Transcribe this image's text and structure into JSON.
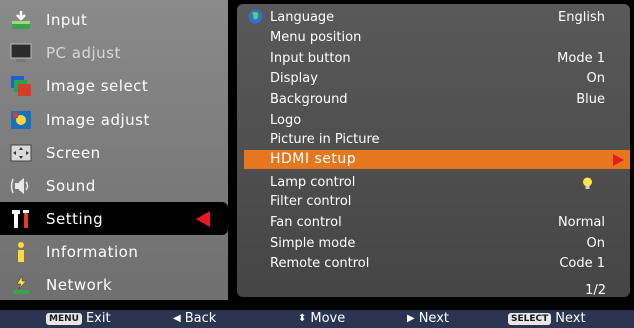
{
  "left_menu": {
    "items": [
      {
        "label": "Input",
        "icon": "input-icon"
      },
      {
        "label": "PC adjust",
        "icon": "pc-adjust-icon"
      },
      {
        "label": "Image select",
        "icon": "image-select-icon"
      },
      {
        "label": "Image adjust",
        "icon": "image-adjust-icon"
      },
      {
        "label": "Screen",
        "icon": "screen-icon"
      },
      {
        "label": "Sound",
        "icon": "sound-icon"
      },
      {
        "label": "Setting",
        "icon": "setting-icon"
      },
      {
        "label": "Information",
        "icon": "information-icon"
      },
      {
        "label": "Network",
        "icon": "network-icon"
      }
    ],
    "selected_index": 6
  },
  "settings": {
    "rows": [
      {
        "label": "Language",
        "value": "English"
      },
      {
        "label": "Menu position",
        "value": ""
      },
      {
        "label": "Input button",
        "value": "Mode 1"
      },
      {
        "label": "Display",
        "value": "On"
      },
      {
        "label": "Background",
        "value": "Blue"
      },
      {
        "label": "Logo",
        "value": ""
      },
      {
        "label": "Picture in Picture",
        "value": ""
      },
      {
        "label": "HDMI setup",
        "value": ""
      },
      {
        "label": "Lamp control",
        "value": ""
      },
      {
        "label": "Filter control",
        "value": ""
      },
      {
        "label": "Fan control",
        "value": "Normal"
      },
      {
        "label": "Simple mode",
        "value": "On"
      },
      {
        "label": "Remote control",
        "value": "Code 1"
      }
    ],
    "highlighted_index": 7,
    "page_indicator": "1/2"
  },
  "footer": {
    "exit_key": "MENU",
    "exit_label": "Exit",
    "back_label": "Back",
    "move_label": "Move",
    "next_label": "Next",
    "select_key": "SELECT",
    "select_next_label": "Next"
  },
  "colors": {
    "highlight": "#e5781e",
    "selection_arrow": "#e8191f",
    "footer_bg": "#2a3552"
  }
}
